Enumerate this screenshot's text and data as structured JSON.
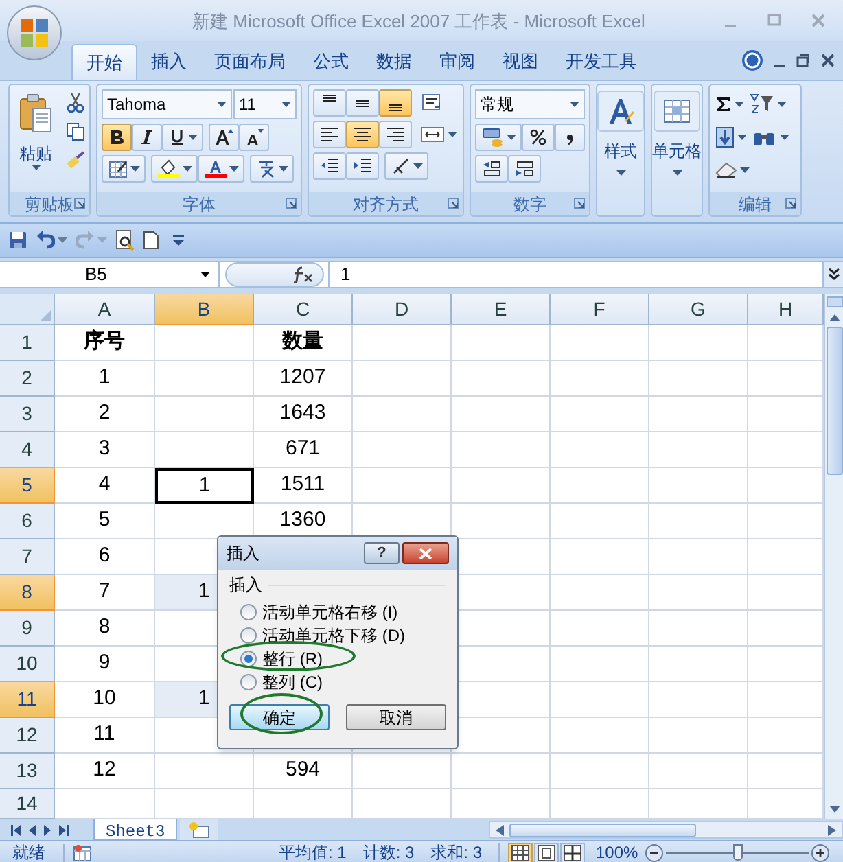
{
  "window": {
    "title": "新建 Microsoft Office Excel 2007 工作表 - Microsoft Excel"
  },
  "tabs": [
    {
      "label": "开始",
      "selected": true
    },
    {
      "label": "插入",
      "selected": false
    },
    {
      "label": "页面布局",
      "selected": false
    },
    {
      "label": "公式",
      "selected": false
    },
    {
      "label": "数据",
      "selected": false
    },
    {
      "label": "审阅",
      "selected": false
    },
    {
      "label": "视图",
      "selected": false
    },
    {
      "label": "开发工具",
      "selected": false
    }
  ],
  "ribbon": {
    "groups": [
      {
        "kind": "clipboard",
        "label": "剪贴板",
        "button": "粘贴"
      },
      {
        "kind": "font",
        "label": "字体",
        "font": "Tahoma",
        "size": "11",
        "bold": true,
        "italic": false,
        "underline": false
      },
      {
        "kind": "alignment",
        "label": "对齐方式",
        "vertical": [
          {
            "selected": false
          },
          {
            "selected": false
          },
          {
            "selected": true
          }
        ],
        "horizontal": [
          {
            "selected": false
          },
          {
            "selected": true
          },
          {
            "selected": false
          }
        ]
      },
      {
        "kind": "number",
        "label": "数字",
        "format": "常规"
      },
      {
        "kind": "styles",
        "button": "样式"
      },
      {
        "kind": "cells",
        "button": "单元格"
      },
      {
        "kind": "editing",
        "label": "编辑"
      }
    ]
  },
  "name_box": "B5",
  "formula": "1",
  "columns": [
    {
      "label": "A",
      "selected": false
    },
    {
      "label": "B",
      "selected": true
    },
    {
      "label": "C",
      "selected": false
    },
    {
      "label": "D",
      "selected": false
    },
    {
      "label": "E",
      "selected": false
    },
    {
      "label": "F",
      "selected": false
    },
    {
      "label": "G",
      "selected": false
    },
    {
      "label": "H",
      "selected": false
    }
  ],
  "rows": [
    {
      "header": "1",
      "selected": false,
      "cells": {
        "A": {
          "text": "序号",
          "bold": true,
          "selected": false,
          "active": false
        },
        "C": {
          "text": "数量",
          "bold": true,
          "selected": false,
          "active": false
        }
      }
    },
    {
      "header": "2",
      "selected": false,
      "cells": {
        "A": {
          "text": "1",
          "bold": false,
          "selected": false,
          "active": false
        },
        "C": {
          "text": "1207",
          "bold": false,
          "selected": false,
          "active": false
        }
      }
    },
    {
      "header": "3",
      "selected": false,
      "cells": {
        "A": {
          "text": "2",
          "bold": false,
          "selected": false,
          "active": false
        },
        "C": {
          "text": "1643",
          "bold": false,
          "selected": false,
          "active": false
        }
      }
    },
    {
      "header": "4",
      "selected": false,
      "cells": {
        "A": {
          "text": "3",
          "bold": false,
          "selected": false,
          "active": false
        },
        "C": {
          "text": "671",
          "bold": false,
          "selected": false,
          "active": false
        }
      }
    },
    {
      "header": "5",
      "selected": true,
      "cells": {
        "A": {
          "text": "4",
          "bold": false,
          "selected": false,
          "active": false
        },
        "B": {
          "text": "1",
          "bold": false,
          "selected": false,
          "active": true
        },
        "C": {
          "text": "1511",
          "bold": false,
          "selected": false,
          "active": false
        }
      }
    },
    {
      "header": "6",
      "selected": false,
      "cells": {
        "A": {
          "text": "5",
          "bold": false,
          "selected": false,
          "active": false
        },
        "C": {
          "text": "1360",
          "bold": false,
          "selected": false,
          "active": false
        }
      }
    },
    {
      "header": "7",
      "selected": false,
      "cells": {
        "A": {
          "text": "6",
          "bold": false,
          "selected": false,
          "active": false
        }
      }
    },
    {
      "header": "8",
      "selected": true,
      "cells": {
        "A": {
          "text": "7",
          "bold": false,
          "selected": false,
          "active": false
        },
        "B": {
          "text": "1",
          "bold": false,
          "selected": true,
          "active": false
        }
      }
    },
    {
      "header": "9",
      "selected": false,
      "cells": {
        "A": {
          "text": "8",
          "bold": false,
          "selected": false,
          "active": false
        }
      }
    },
    {
      "header": "10",
      "selected": false,
      "cells": {
        "A": {
          "text": "9",
          "bold": false,
          "selected": false,
          "active": false
        }
      }
    },
    {
      "header": "11",
      "selected": true,
      "cells": {
        "A": {
          "text": "10",
          "bold": false,
          "selected": false,
          "active": false
        },
        "B": {
          "text": "1",
          "bold": false,
          "selected": true,
          "active": false
        }
      }
    },
    {
      "header": "12",
      "selected": false,
      "cells": {
        "A": {
          "text": "11",
          "bold": false,
          "selected": false,
          "active": false
        }
      }
    },
    {
      "header": "13",
      "selected": false,
      "cells": {
        "A": {
          "text": "12",
          "bold": false,
          "selected": false,
          "active": false
        },
        "C": {
          "text": "594",
          "bold": false,
          "selected": false,
          "active": false
        }
      }
    },
    {
      "header": "14",
      "selected": false
    }
  ],
  "dialog": {
    "title": "插入",
    "help_button": "?",
    "group_label": "插入",
    "options": [
      {
        "label": "活动单元格右移 (I)",
        "selected": false,
        "circled": false
      },
      {
        "label": "活动单元格下移 (D)",
        "selected": false,
        "circled": false
      },
      {
        "label": "整行 (R)",
        "selected": true,
        "circled": true
      },
      {
        "label": "整列 (C)",
        "selected": false,
        "circled": false
      }
    ],
    "buttons": [
      {
        "label": "确定",
        "default": true,
        "circled": true
      },
      {
        "label": "取消",
        "default": false,
        "circled": false
      }
    ]
  },
  "sheet_tabs": [
    {
      "label": "Sheet3",
      "selected": true
    }
  ],
  "status_bar": {
    "mode": "就绪",
    "stats": [
      "平均值: 1",
      "计数: 3",
      "求和: 3"
    ],
    "views": [
      {
        "kind": "normal",
        "selected": true
      },
      {
        "kind": "page-layout",
        "selected": false
      },
      {
        "kind": "page-break",
        "selected": false
      }
    ],
    "zoom": "100%",
    "zoom_slider": {
      "level": 0.5
    }
  }
}
